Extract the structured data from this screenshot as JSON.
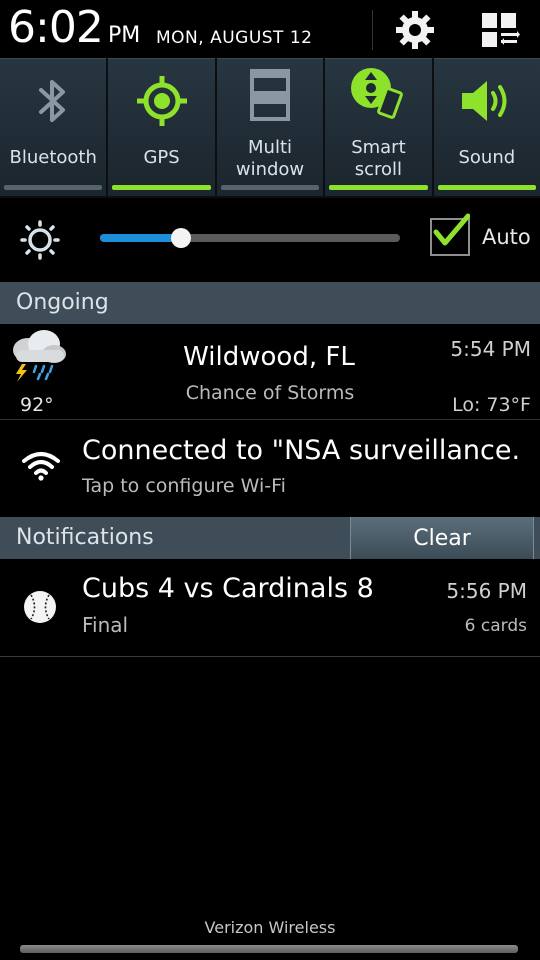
{
  "status": {
    "time": "6:02",
    "ampm": "PM",
    "date": "MON, AUGUST 12"
  },
  "toggles": [
    {
      "label": "Bluetooth",
      "icon": "bluetooth-icon",
      "on": false
    },
    {
      "label": "GPS",
      "icon": "gps-icon",
      "on": true
    },
    {
      "label_line1": "Multi",
      "label_line2": "window",
      "icon": "multi-window-icon",
      "on": false
    },
    {
      "label_line1": "Smart",
      "label_line2": "scroll",
      "icon": "smart-scroll-icon",
      "on": true
    },
    {
      "label": "Sound",
      "icon": "sound-icon",
      "on": true
    }
  ],
  "brightness": {
    "level": 0.27,
    "auto_label": "Auto",
    "auto_checked": true
  },
  "ongoing": {
    "header": "Ongoing",
    "weather": {
      "city": "Wildwood, FL",
      "condition": "Chance of Storms",
      "temp": "92°",
      "time": "5:54 PM",
      "low": "Lo: 73°F"
    },
    "wifi": {
      "title": "Connected to \"NSA surveillance..",
      "subtitle": "Tap to configure Wi-Fi"
    }
  },
  "notifications": {
    "header": "Notifications",
    "clear_label": "Clear",
    "items": [
      {
        "title": "Cubs 4 vs Cardinals 8",
        "subtitle": "Final",
        "time": "5:56 PM",
        "count": "6 cards"
      }
    ]
  },
  "footer": {
    "carrier": "Verizon Wireless"
  },
  "colors": {
    "accent_green": "#8ee22b",
    "slider_blue": "#1d8ed7",
    "section_bg": "#3e4d57"
  }
}
